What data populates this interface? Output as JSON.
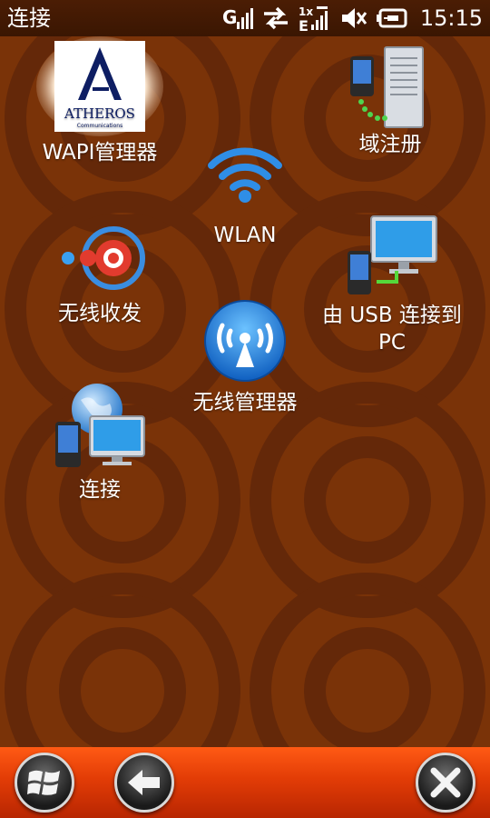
{
  "status_bar": {
    "title": "连接",
    "time": "15:15",
    "network_label": "1x",
    "icons": [
      "signal-strength-icon",
      "data-transfer-icon",
      "1x-network-icon",
      "speaker-muted-icon",
      "battery-icon"
    ]
  },
  "apps": [
    {
      "label": "WAPI管理器",
      "icon": "atheros-logo-icon",
      "logo_text": "ATHEROS",
      "logo_subtext": "Communications"
    },
    {
      "label": "域注册",
      "icon": "domain-enroll-icon"
    },
    {
      "label": "WLAN",
      "icon": "wifi-icon"
    },
    {
      "label": "无线收发",
      "icon": "beam-icon"
    },
    {
      "label_line1": "由 USB 连接到",
      "label_line2": "PC",
      "icon": "usb-to-pc-icon"
    },
    {
      "label": "无线管理器",
      "icon": "wireless-manager-icon"
    },
    {
      "label": "连接",
      "icon": "connections-icon"
    }
  ],
  "bottom_bar": {
    "buttons": [
      "windows-start-icon",
      "back-arrow-icon",
      "close-icon"
    ]
  },
  "colors": {
    "background": "#7a3308",
    "ring": "#6a2a05",
    "bottom_bar": "#e23c06"
  }
}
